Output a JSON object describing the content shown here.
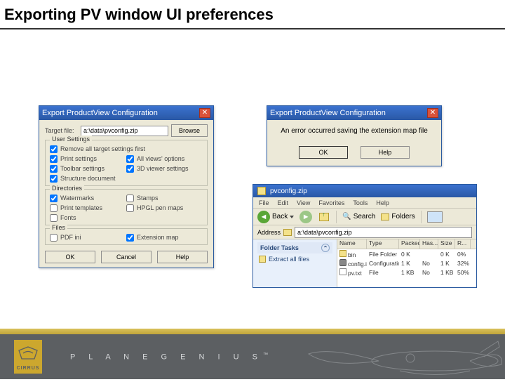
{
  "page": {
    "title": "Exporting PV window UI preferences"
  },
  "exportDialog": {
    "title": "Export ProductView Configuration",
    "targetLabel": "Target file:",
    "targetValue": "a:\\data\\pvconfig.zip",
    "browse": "Browse",
    "removeAll": "Remove all target settings first",
    "groups": {
      "userSettings": {
        "title": "User Settings",
        "items": [
          {
            "label": "Print settings",
            "checked": true
          },
          {
            "label": "All views' options",
            "checked": true
          },
          {
            "label": "Toolbar settings",
            "checked": true
          },
          {
            "label": "3D viewer settings",
            "checked": true
          },
          {
            "label": "Structure document",
            "checked": true
          }
        ]
      },
      "directories": {
        "title": "Directories",
        "items": [
          {
            "label": "Watermarks",
            "checked": true
          },
          {
            "label": "Stamps",
            "checked": false
          },
          {
            "label": "Print templates",
            "checked": false
          },
          {
            "label": "HPGL pen maps",
            "checked": false
          },
          {
            "label": "Fonts",
            "checked": false
          }
        ]
      },
      "files": {
        "title": "Files",
        "items": [
          {
            "label": "PDF ini",
            "checked": false
          },
          {
            "label": "Extension map",
            "checked": true
          }
        ]
      }
    },
    "buttons": {
      "ok": "OK",
      "cancel": "Cancel",
      "help": "Help"
    }
  },
  "errorDialog": {
    "title": "Export ProductView Configuration",
    "message": "An error occurred saving the extension map file",
    "ok": "OK",
    "help": "Help"
  },
  "explorer": {
    "title": "pvconfig.zip",
    "menu": [
      "File",
      "Edit",
      "View",
      "Favorites",
      "Tools",
      "Help"
    ],
    "back": "Back",
    "search": "Search",
    "folders": "Folders",
    "addressLabel": "Address",
    "addressValue": "a:\\data\\pvconfig.zip",
    "sideHead": "Folder Tasks",
    "sideLink": "Extract all files",
    "columns": [
      "Name",
      "Type",
      "Packed...",
      "Has...",
      "Size",
      "R..."
    ],
    "rows": [
      {
        "icon": "folder",
        "name": "bin",
        "type": "File Folder",
        "packed": "0 K",
        "has": "",
        "size": "0 K",
        "ratio": "0%"
      },
      {
        "icon": "gear",
        "name": "config.ini",
        "type": "Configuration...",
        "packed": "1 K",
        "has": "No",
        "size": "1 K",
        "ratio": "32%"
      },
      {
        "icon": "file",
        "name": "pv.txt",
        "type": "File",
        "packed": "1 KB",
        "has": "No",
        "size": "1 KB",
        "ratio": "50%"
      }
    ]
  },
  "footer": {
    "cirrus": "CIRRUS",
    "brand": "P L A N E   G E N I U S",
    "tm": "™"
  }
}
